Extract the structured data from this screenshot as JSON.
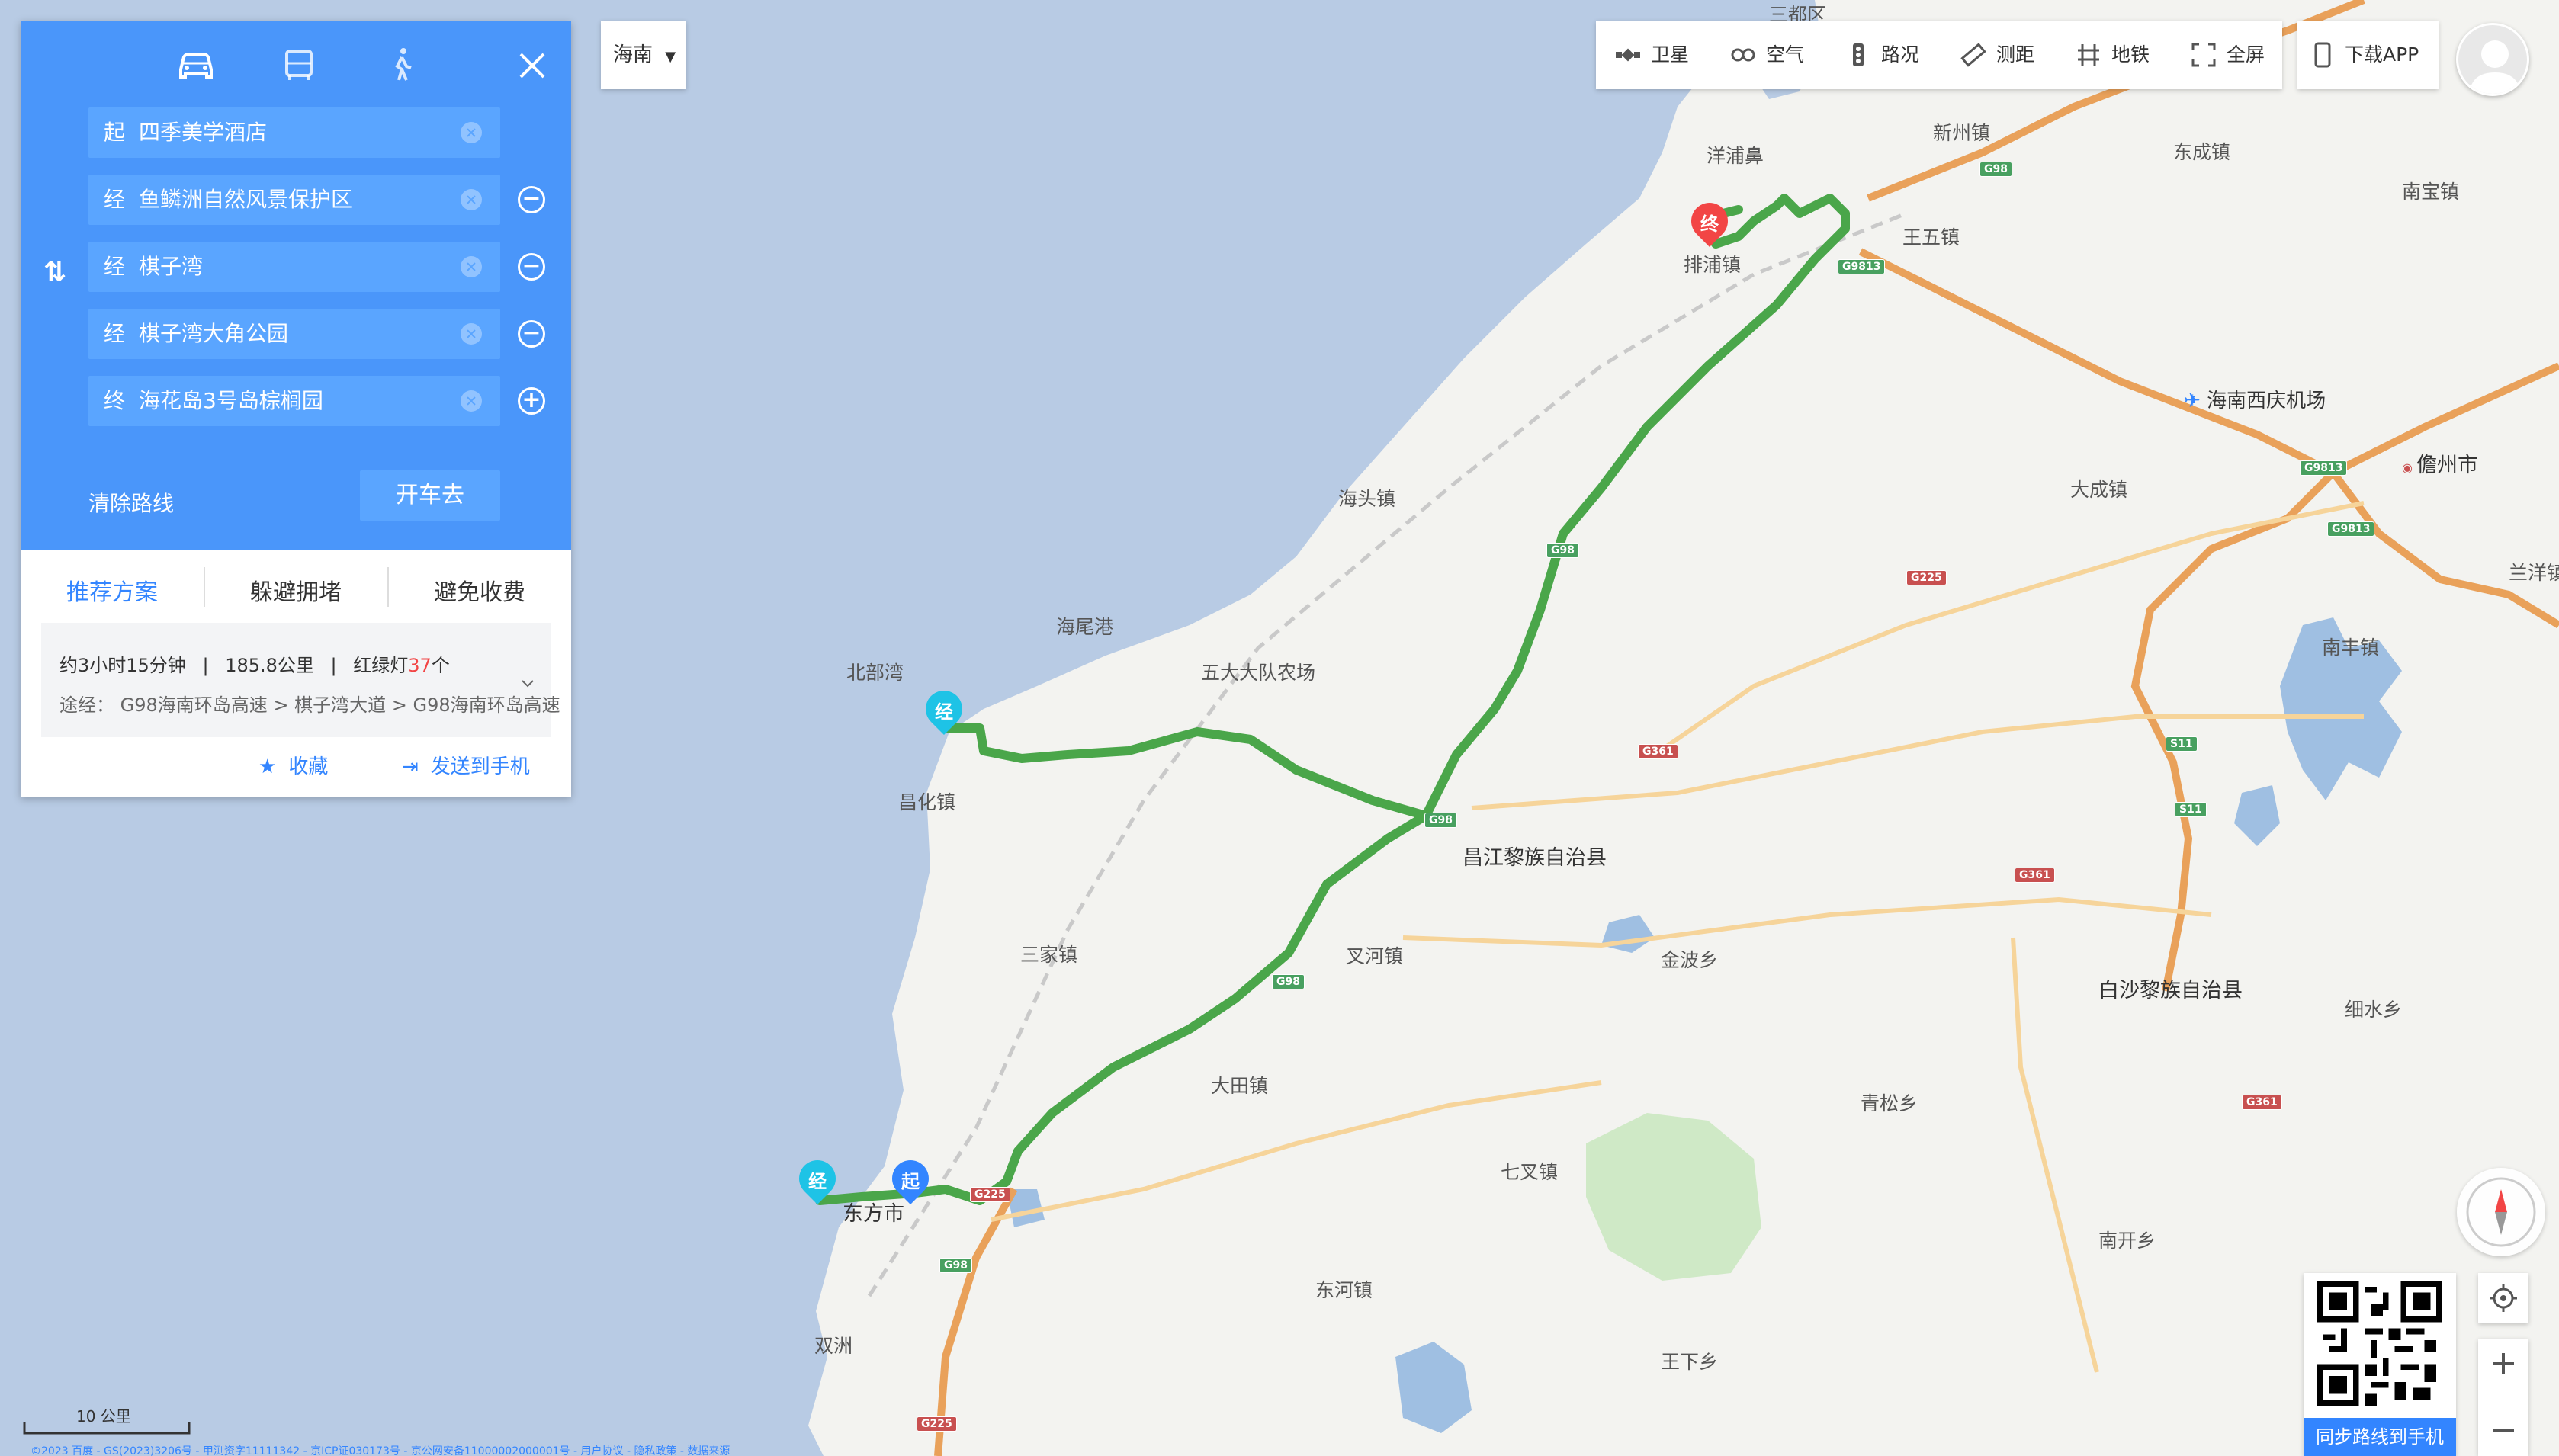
{
  "panel": {
    "modes": [
      "car-icon",
      "bus-icon",
      "walk-icon"
    ],
    "stops": [
      {
        "tag": "起",
        "name": "四季美学酒店",
        "control": ""
      },
      {
        "tag": "经",
        "name": "鱼鳞洲自然风景保护区",
        "control": "−"
      },
      {
        "tag": "经",
        "name": "棋子湾",
        "control": "−"
      },
      {
        "tag": "经",
        "name": "棋子湾大角公园",
        "control": "−"
      },
      {
        "tag": "终",
        "name": "海花岛3号岛棕榈园",
        "control": "+"
      }
    ],
    "clear_label": "清除路线",
    "drive_label": "开车去",
    "tabs": [
      "推荐方案",
      "躲避拥堵",
      "避免收费"
    ],
    "summary": {
      "duration": "约3小时15分钟",
      "distance": "185.8公里",
      "lights_prefix": "红绿灯",
      "lights_count": "37",
      "lights_suffix": "个",
      "via_prefix": "途经：",
      "via": "G98海南环岛高速 > 棋子湾大道 > G98海南环岛高速"
    },
    "favorite_label": "收藏",
    "send_label": "发送到手机"
  },
  "region": {
    "label": "海南"
  },
  "toolbar": {
    "items": [
      {
        "icon": "satellite-icon",
        "label": "卫星"
      },
      {
        "icon": "air-icon",
        "label": "空气"
      },
      {
        "icon": "traffic-icon",
        "label": "路况"
      },
      {
        "icon": "ruler-icon",
        "label": "测距"
      },
      {
        "icon": "subway-icon",
        "label": "地铁"
      },
      {
        "icon": "fullscreen-icon",
        "label": "全屏"
      }
    ],
    "download_label": "下载APP"
  },
  "map": {
    "labels": [
      {
        "text": "三都区",
        "kind": "town"
      },
      {
        "text": "新州镇",
        "kind": "town"
      },
      {
        "text": "东成镇",
        "kind": "town"
      },
      {
        "text": "南宝镇",
        "kind": "town"
      },
      {
        "text": "洋浦鼻",
        "kind": "town"
      },
      {
        "text": "排浦镇",
        "kind": "town"
      },
      {
        "text": "王五镇",
        "kind": "town"
      },
      {
        "text": "海南西庆机场",
        "kind": "airport"
      },
      {
        "text": "儋州市",
        "kind": "city"
      },
      {
        "text": "大成镇",
        "kind": "town"
      },
      {
        "text": "海头镇",
        "kind": "town"
      },
      {
        "text": "兰洋镇",
        "kind": "town"
      },
      {
        "text": "海尾港",
        "kind": "town"
      },
      {
        "text": "北部湾",
        "kind": "town"
      },
      {
        "text": "五大大队农场",
        "kind": "town"
      },
      {
        "text": "南丰镇",
        "kind": "town"
      },
      {
        "text": "昌化镇",
        "kind": "town"
      },
      {
        "text": "昌江黎族自治县",
        "kind": "city"
      },
      {
        "text": "三家镇",
        "kind": "town"
      },
      {
        "text": "叉河镇",
        "kind": "town"
      },
      {
        "text": "金波乡",
        "kind": "town"
      },
      {
        "text": "白沙黎族自治县",
        "kind": "city"
      },
      {
        "text": "细水乡",
        "kind": "town"
      },
      {
        "text": "大田镇",
        "kind": "town"
      },
      {
        "text": "青松乡",
        "kind": "town"
      },
      {
        "text": "七叉镇",
        "kind": "town"
      },
      {
        "text": "东方市",
        "kind": "city"
      },
      {
        "text": "南开乡",
        "kind": "town"
      },
      {
        "text": "东河镇",
        "kind": "town"
      },
      {
        "text": "双洲",
        "kind": "town"
      },
      {
        "text": "王下乡",
        "kind": "town"
      }
    ],
    "shields": [
      {
        "text": "G98",
        "color": "green"
      },
      {
        "text": "G9813",
        "color": "green"
      },
      {
        "text": "G98",
        "color": "green"
      },
      {
        "text": "G9813",
        "color": "green"
      },
      {
        "text": "G9813",
        "color": "green"
      },
      {
        "text": "G225",
        "color": "red"
      },
      {
        "text": "G361",
        "color": "red"
      },
      {
        "text": "S11",
        "color": "green"
      },
      {
        "text": "S11",
        "color": "green"
      },
      {
        "text": "G98",
        "color": "green"
      },
      {
        "text": "G361",
        "color": "red"
      },
      {
        "text": "G98",
        "color": "green"
      },
      {
        "text": "G361",
        "color": "red"
      },
      {
        "text": "G225",
        "color": "red"
      },
      {
        "text": "G98",
        "color": "green"
      },
      {
        "text": "G225",
        "color": "red"
      }
    ],
    "pins": [
      {
        "text": "终",
        "color": "#f24545"
      },
      {
        "text": "经",
        "color": "#1ec3e6"
      },
      {
        "text": "经",
        "color": "#1ec3e6"
      },
      {
        "text": "起",
        "color": "#3385ff"
      }
    ],
    "colors": {
      "sea": "#b8cbe4",
      "land": "#f3f3f0",
      "route": "#4aa64a",
      "lake": "#9fbfe2",
      "park": "#cfe9c6"
    }
  },
  "scale": {
    "label": "10 公里"
  },
  "qr": {
    "caption": "同步路线到手机"
  },
  "footer": {
    "text": "©2023 百度 - GS(2023)3206号 - 甲测资字11111342 - 京ICP证030173号 - 京公网安备11000002000001号 - 用户协议 - 隐私政策 - 数据来源"
  }
}
